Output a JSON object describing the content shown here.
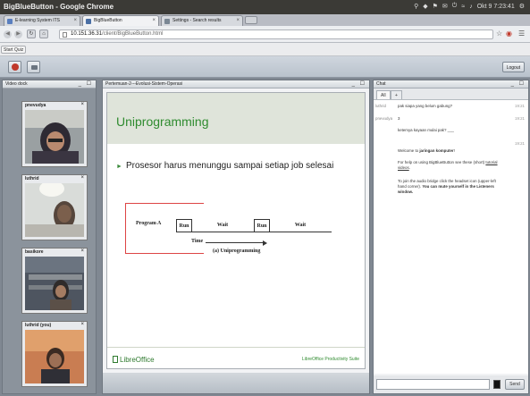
{
  "os": {
    "window_title": "BigBlueButton - Google Chrome",
    "clock": "Okt 9  7:23:41"
  },
  "browser": {
    "tabs": [
      {
        "label": "E-learning System ITS"
      },
      {
        "label": "BigBlueButton"
      },
      {
        "label": "Settings - Search results"
      }
    ],
    "url_host": "10.151.36.31",
    "url_path": "/client/BigBlueButton.html",
    "bookmark": "Start Quiz"
  },
  "toolbar": {
    "logout_label": "Logout"
  },
  "video_dock": {
    "title": "Video dock",
    "videos": [
      {
        "name": "pnevudya"
      },
      {
        "name": "luthrid"
      },
      {
        "name": "basikore"
      },
      {
        "name": "luthrid (you)"
      }
    ]
  },
  "presentation": {
    "title": "Pertemuan-2---Evolusi-Sistem-Operasi",
    "slide_title": "Uniprogramming",
    "bullet": "Prosesor harus menunggu sampai setiap job selesai",
    "diagram": {
      "program_label": "Program A",
      "run1": "Run",
      "wait1": "Wait",
      "run2": "Run",
      "wait2": "Wait",
      "time": "Time",
      "caption": "(a) Uniprogramming"
    },
    "footer_logo": "LibreOffice",
    "footer_suite": "LibreOffice Productivity Suite"
  },
  "chat": {
    "title": "Chat",
    "tabs": [
      {
        "label": "All"
      },
      {
        "label": "+"
      }
    ],
    "messages": [
      {
        "who": "luthrid",
        "text": "pak siapa yang belum gabung?",
        "time": "19:21"
      },
      {
        "who": "pnevudya",
        "text": "3",
        "time": "19:21"
      },
      {
        "who": "",
        "text": "ketemya kayaan mulai pak? ___",
        "time": ""
      },
      {
        "who": "",
        "text": "",
        "time": "19:21"
      }
    ],
    "welcome": {
      "line1_pre": "Welcome to ",
      "line1_bold": "jaringan komputer",
      "line1_post": "!",
      "line2_pre": "For help on using BigBlueButton see these (short) ",
      "line2_link": "tutorial videos",
      "line2_post": ".",
      "line3_pre": "To join the audio bridge click the headset icon (upper-left hand corner). ",
      "line3_bold": "You can mute yourself in the Listeners window."
    },
    "send_label": "Send"
  }
}
